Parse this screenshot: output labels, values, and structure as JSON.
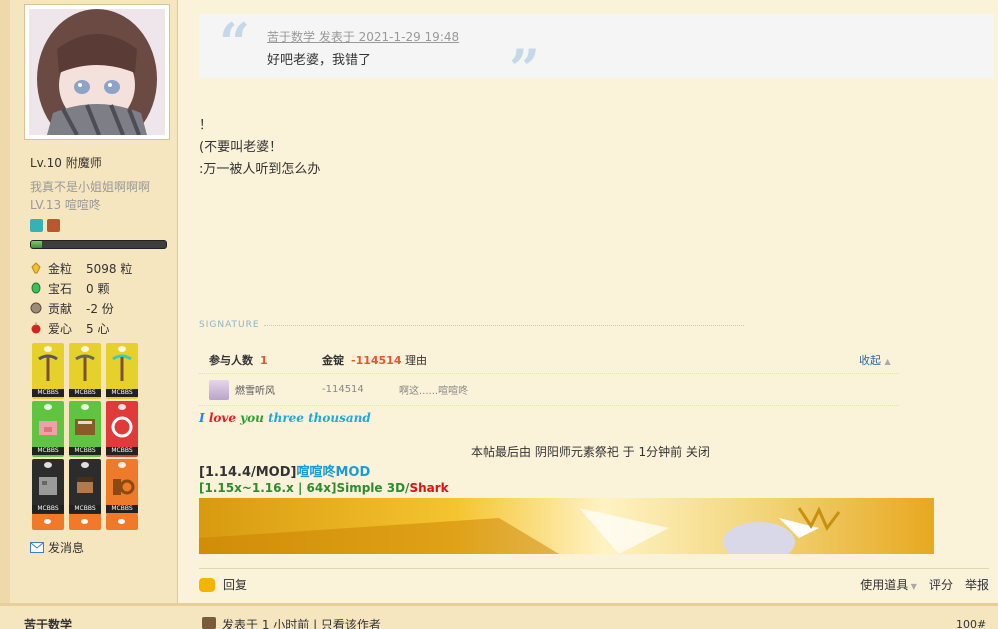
{
  "user": {
    "level": "Lv.10 附魔师",
    "subtitle1": "我真不是小姐姐啊啊啊",
    "subtitle2": "LV.13 喧喧咚",
    "stats": [
      {
        "icon": "gold-nugget-icon",
        "label": "金粒",
        "value": "5098 粒"
      },
      {
        "icon": "emerald-icon",
        "label": "宝石",
        "value": "0 颗"
      },
      {
        "icon": "contribution-icon",
        "label": "贡献",
        "value": "-2 份"
      },
      {
        "icon": "apple-icon",
        "label": "爱心",
        "value": "5 心"
      }
    ],
    "badge_text": "MCBBS",
    "send_message": "发消息",
    "exp_progress": 0.08
  },
  "post": {
    "quote_author": "苦于数学 发表于 2021-1-29 19:48",
    "quote_text": "好吧老婆，我错了",
    "lines": [
      "！",
      "(不要叫老婆！",
      ":万一被人听到怎么办"
    ]
  },
  "signature_label": "SIGNATURE",
  "rating": {
    "participants_label": "参与人数",
    "participants": "1",
    "ingot_label": "金锭",
    "ingot_value": "-114514",
    "reason_label": "理由",
    "collapse": "收起",
    "rows": [
      {
        "name": "燃雪听风",
        "score": "-114514",
        "reason": "啊这......喧喧咚"
      }
    ]
  },
  "sig": {
    "love_words": [
      "I",
      "love",
      "you",
      "three thousand"
    ],
    "edited": "本帖最后由 阴阳师元素祭祀 于 1分钟前 关闭",
    "mod_prefix": "[1.14.4/MOD]",
    "mod_name": "喧喧咚MOD",
    "mod2_prefix": "[1.15x~1.16.x | 64x]Simple 3D/",
    "mod2_suffix": "Shark"
  },
  "footer": {
    "reply": "回复",
    "use_tool": "使用道具",
    "rate": "评分",
    "report": "举报"
  },
  "next_post": {
    "author": "苦于数学",
    "meta": "发表于 1 小时前  |  只看该作者",
    "floor": "100#"
  }
}
